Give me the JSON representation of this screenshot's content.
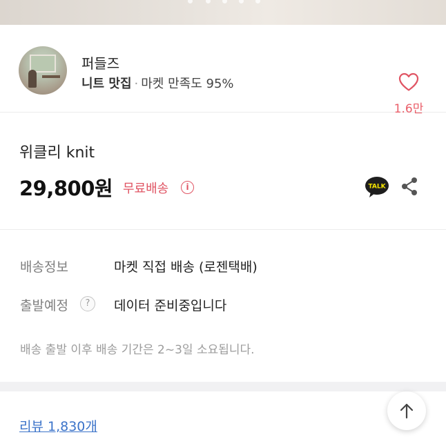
{
  "seller": {
    "name": "퍼들즈",
    "badge": "니트 맛집",
    "separator": "·",
    "satisfaction": "마켓 만족도 95%",
    "like_count": "1.6만"
  },
  "product": {
    "title": "위클리 knit",
    "price": "29,800원",
    "shipping_badge": "무료배송",
    "info_glyph": "i"
  },
  "delivery": {
    "info_label": "배송정보",
    "info_value": "마켓 직접 배송 (로젠택배)",
    "departure_label": "출발예정",
    "help_glyph": "?",
    "departure_value": "데이터 준비중입니다",
    "note": "배송 출발 이후 배송 기간은 2~3일 소요됩니다."
  },
  "reviews": {
    "link_text": "리뷰 1,830개"
  },
  "icons": {
    "heart": "heart-outline-icon",
    "talk": "kakaotalk-icon",
    "share": "share-icon",
    "up": "arrow-up-icon"
  },
  "colors": {
    "accent_red": "#e05463",
    "link_blue": "#3b73c9",
    "kakao_dark": "#1e1e1e"
  }
}
